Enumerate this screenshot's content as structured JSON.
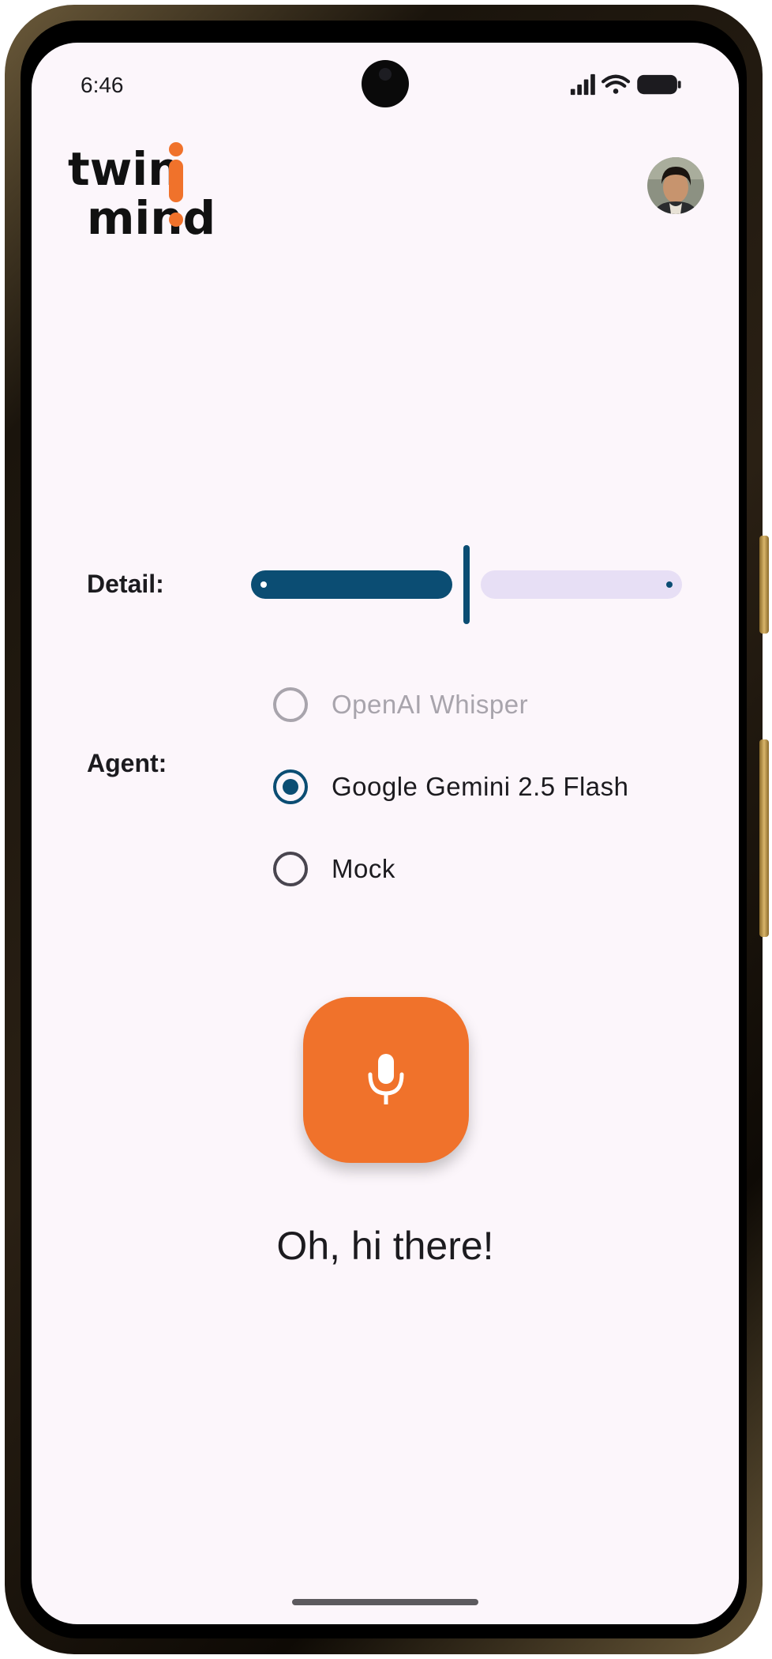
{
  "status_bar": {
    "time": "6:46",
    "icons": [
      "signal-icon",
      "wifi-icon",
      "battery-icon"
    ]
  },
  "header": {
    "logo_text_line1": "twin",
    "logo_text_line2": "mind",
    "logo_accent_color": "#f0722b",
    "avatar_icon": "user-avatar"
  },
  "detail": {
    "label": "Detail:",
    "level_fraction": 0.5,
    "active_color": "#0b4d73",
    "inactive_color": "#e7dff5"
  },
  "agent": {
    "label": "Agent:",
    "options": [
      {
        "label": "OpenAI Whisper",
        "state": "disabled"
      },
      {
        "label": "Google Gemini 2.5 Flash",
        "state": "selected"
      },
      {
        "label": "Mock",
        "state": "unselected"
      }
    ]
  },
  "mic_button": {
    "icon": "microphone-icon",
    "color": "#f0722b"
  },
  "greeting": "Oh, hi there!"
}
